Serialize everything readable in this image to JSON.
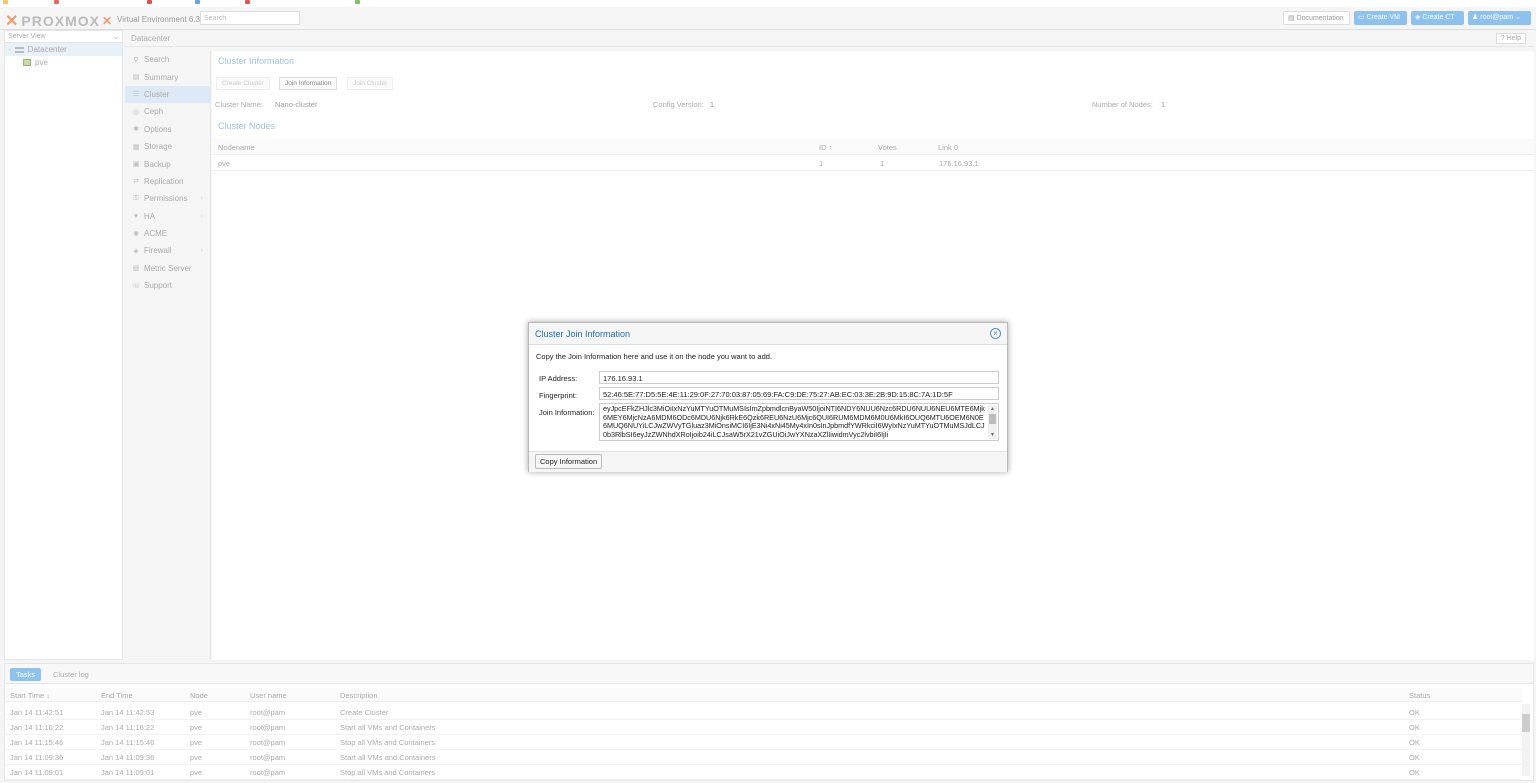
{
  "header": {
    "logo_text": "PROXMOX",
    "version": "Virtual Environment 6.3-2",
    "search_placeholder": "Search",
    "documentation": "Documentation",
    "create_vm": "Create VM",
    "create_ct": "Create CT",
    "user": "root@pam"
  },
  "tree": {
    "view": "Server View",
    "datacenter": "Datacenter",
    "node": "pve"
  },
  "breadcrumb": {
    "title": "Datacenter",
    "help": "Help"
  },
  "menu": [
    {
      "label": "Search",
      "icon": "search-icon",
      "glyph": "⚲"
    },
    {
      "label": "Summary",
      "icon": "book-icon",
      "glyph": "▤"
    },
    {
      "label": "Cluster",
      "icon": "list-icon",
      "glyph": "☰"
    },
    {
      "label": "Ceph",
      "icon": "ceph-icon",
      "glyph": "◎"
    },
    {
      "label": "Options",
      "icon": "gear-icon",
      "glyph": "✱"
    },
    {
      "label": "Storage",
      "icon": "database-icon",
      "glyph": "▦"
    },
    {
      "label": "Backup",
      "icon": "floppy-icon",
      "glyph": "▣"
    },
    {
      "label": "Replication",
      "icon": "retweet-icon",
      "glyph": "⇄"
    },
    {
      "label": "Permissions",
      "icon": "unlock-icon",
      "glyph": "⚿"
    },
    {
      "label": "HA",
      "icon": "heartbeat-icon",
      "glyph": "♥"
    },
    {
      "label": "ACME",
      "icon": "certificate-icon",
      "glyph": "✺"
    },
    {
      "label": "Firewall",
      "icon": "shield-icon",
      "glyph": "◈"
    },
    {
      "label": "Metric Server",
      "icon": "chart-icon",
      "glyph": "▥"
    },
    {
      "label": "Support",
      "icon": "comments-icon",
      "glyph": "☏"
    }
  ],
  "cluster": {
    "info_title": "Cluster Information",
    "create_cluster": "Create Cluster",
    "join_information": "Join Information",
    "join_cluster": "Join Cluster",
    "name_label": "Cluster Name:",
    "name_value": "Nano-cluster",
    "config_label": "Config Version:",
    "config_value": "1",
    "nodes_label": "Number of Nodes:",
    "nodes_value": "1",
    "nodes_title": "Cluster Nodes",
    "columns": [
      "Nodename",
      "ID ↑",
      "Votes",
      "Link 0"
    ],
    "rows": [
      {
        "name": "pve",
        "id": "1",
        "votes": "1",
        "link": "176.16.93.1"
      }
    ]
  },
  "dialog": {
    "title": "Cluster Join Information",
    "intro": "Copy the Join Information here and use it on the node you want to add.",
    "ip_label": "IP Address:",
    "ip_value": "176.16.93.1",
    "fp_label": "Fingerprint:",
    "fp_value": "52:46:5E:77:D5:5E:4E:11:29:0F:27:70:03:87:05:69:FA:C9:DE:75:27:AB:EC:03:3E:2B:9D:15:8C:7A:1D:5F",
    "join_label": "Join Information:",
    "join_value": "eyJpcEFkZHJlc3MiOiIxNzYuMTYuOTMuMSIsImZpbmdlcnByaW50IjoiNTI6NDY6NUU6Nzc6RDU6NUU6NEU6MTE6Mjk6MEY6MjcNzA6MDM6ODc6MDU6Njk6RkE6Qzk6REU6NzU6Mjc6QUI6RUM6MDM6M0U6MkI6OUQ6MTU6OEM6N0E6MUQ6NUYiLCJwZWVyTGluaz3MiOnsiMCI6IjE3Ni4xNi45My4xIn0sInJpbmdfYWRkciI6WyIxNzYuMTYuOTMuMSJdLCJ0b3RlbSI6eyJzZWNhdXRoIjoib24iLCJsaW5rX21vZGUiOiJwYXNzaXZlIiwidmVyc2lvbiI6IjIi",
    "copy_button": "Copy Information"
  },
  "log": {
    "tabs": [
      "Tasks",
      "Cluster log"
    ],
    "columns": [
      "Start Time ↓",
      "End Time",
      "Node",
      "User name",
      "Description",
      "Status"
    ],
    "rows": [
      {
        "start": "Jan 14 11:42:51",
        "end": "Jan 14 11:42:53",
        "node": "pve",
        "user": "root@pam",
        "desc": "Create Cluster",
        "status": "OK"
      },
      {
        "start": "Jan 14 11:16:22",
        "end": "Jan 14 11:16:22",
        "node": "pve",
        "user": "root@pam",
        "desc": "Start all VMs and Containers",
        "status": "OK"
      },
      {
        "start": "Jan 14 11:15:46",
        "end": "Jan 14 11:15:46",
        "node": "pve",
        "user": "root@pam",
        "desc": "Stop all VMs and Containers",
        "status": "OK"
      },
      {
        "start": "Jan 14 11:09:36",
        "end": "Jan 14 11:09:36",
        "node": "pve",
        "user": "root@pam",
        "desc": "Start all VMs and Containers",
        "status": "OK"
      },
      {
        "start": "Jan 14 11:09:01",
        "end": "Jan 14 11:09:01",
        "node": "pve",
        "user": "root@pam",
        "desc": "Stop all VMs and Containers",
        "status": "OK"
      }
    ]
  },
  "colors": {
    "accent": "#1a70c1",
    "button_blue": "#8dc1ee"
  }
}
